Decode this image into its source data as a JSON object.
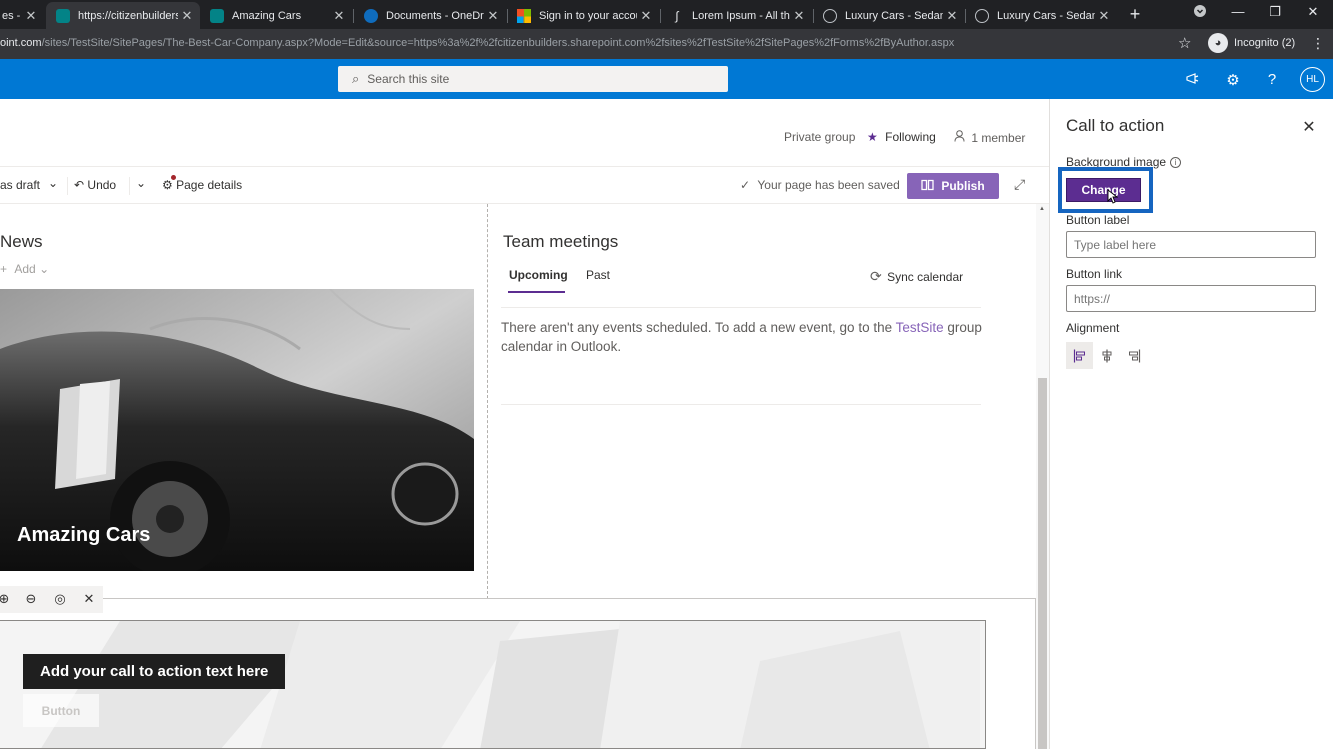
{
  "browser": {
    "tabs": [
      {
        "title": "es -",
        "active": false
      },
      {
        "title": "https://citizenbuilders.",
        "active": true
      },
      {
        "title": "Amazing Cars",
        "active": false
      },
      {
        "title": "Documents - OneDrive",
        "active": false
      },
      {
        "title": "Sign in to your accoun",
        "active": false
      },
      {
        "title": "Lorem Ipsum - All the",
        "active": false
      },
      {
        "title": "Luxury Cars - Sedans,",
        "active": false
      },
      {
        "title": "Luxury Cars - Sedans,",
        "active": false
      }
    ],
    "url_host": "oint.com",
    "url_path": "/sites/TestSite/SitePages/The-Best-Car-Company.aspx?Mode=Edit&source=https%3a%2f%2fcitizenbuilders.sharepoint.com%2fsites%2fTestSite%2fSitePages%2fForms%2fByAuthor.aspx",
    "incognito_label": "Incognito (2)"
  },
  "suitebar": {
    "search_placeholder": "Search this site",
    "avatar_initials": "HL",
    "color": "#0078d4"
  },
  "site_header": {
    "privacy": "Private group",
    "following": "Following",
    "members": "1 member"
  },
  "commandbar": {
    "save_draft": "as draft",
    "undo": "Undo",
    "page_details": "Page details",
    "saved_status": "Your page has been saved",
    "publish": "Publish"
  },
  "news": {
    "title": "News",
    "add": "Add",
    "hero_title": "Amazing Cars"
  },
  "team_meetings": {
    "title": "Team meetings",
    "tabs": [
      "Upcoming",
      "Past"
    ],
    "sync": "Sync calendar",
    "message_before": "There aren't any events scheduled. To add a new event, go to the ",
    "message_link": "TestSite",
    "message_after": " group calendar in Outlook."
  },
  "call_to_action_webpart": {
    "text": "Add your call to action text here",
    "button": "Button"
  },
  "property_pane": {
    "title": "Call to action",
    "background_image_label": "Background image",
    "change_button": "Change",
    "button_label_label": "Button label",
    "button_label_placeholder": "Type label here",
    "button_link_label": "Button link",
    "button_link_placeholder": "https://",
    "alignment_label": "Alignment",
    "alignment_selected": "left",
    "accent": "#5c2d91"
  }
}
